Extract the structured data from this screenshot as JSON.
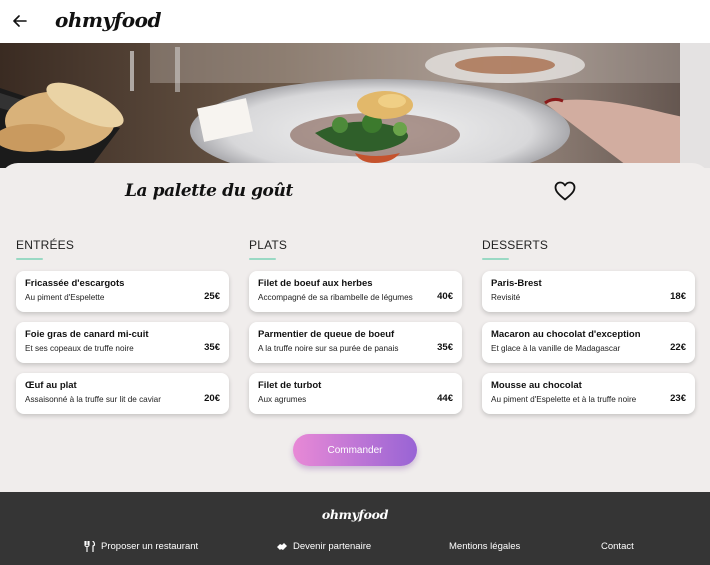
{
  "header": {
    "logo": "ohmyfood",
    "back_icon": "arrow-left-icon"
  },
  "restaurant": {
    "name": "La palette du goût",
    "favorite_icon": "heart-outline-icon"
  },
  "menu": {
    "columns": [
      {
        "title": "ENTRÉES",
        "dishes": [
          {
            "name": "Fricassée d'escargots",
            "description": "Au piment d'Espelette",
            "price": "25€"
          },
          {
            "name": "Foie gras de canard mi-cuit",
            "description": "Et ses copeaux de truffe noire",
            "price": "35€"
          },
          {
            "name": "Œuf au plat",
            "description": "Assaisonné à la truffe sur lit de caviar",
            "price": "20€"
          }
        ]
      },
      {
        "title": "PLATS",
        "dishes": [
          {
            "name": "Filet de boeuf aux herbes",
            "description": "Accompagné de sa ribambelle de légumes",
            "price": "40€"
          },
          {
            "name": "Parmentier de queue de boeuf",
            "description": "A la truffe noire sur sa purée de panais",
            "price": "35€"
          },
          {
            "name": "Filet de turbot",
            "description": "Aux agrumes",
            "price": "44€"
          }
        ]
      },
      {
        "title": "DESSERTS",
        "dishes": [
          {
            "name": "Paris-Brest",
            "description": "Revisité",
            "price": "18€"
          },
          {
            "name": "Macaron au chocolat d'exception",
            "description": "Et glace à la vanille de Madagascar",
            "price": "22€"
          },
          {
            "name": "Mousse au chocolat",
            "description": "Au piment d'Espelette et à la truffe noire",
            "price": "23€"
          }
        ]
      }
    ]
  },
  "order_button": {
    "label": "Commander"
  },
  "footer": {
    "logo": "ohmyfood",
    "links": [
      {
        "label": "Proposer un restaurant",
        "icon": "utensils-icon"
      },
      {
        "label": "Devenir partenaire",
        "icon": "handshake-icon"
      },
      {
        "label": "Mentions légales"
      },
      {
        "label": "Contact"
      }
    ]
  },
  "colors": {
    "accent_underline": "#9ad9c4",
    "button_start": "#e889d6",
    "button_end": "#9864d5",
    "footer_bg": "#353535",
    "page_bg": "#f0edec"
  }
}
